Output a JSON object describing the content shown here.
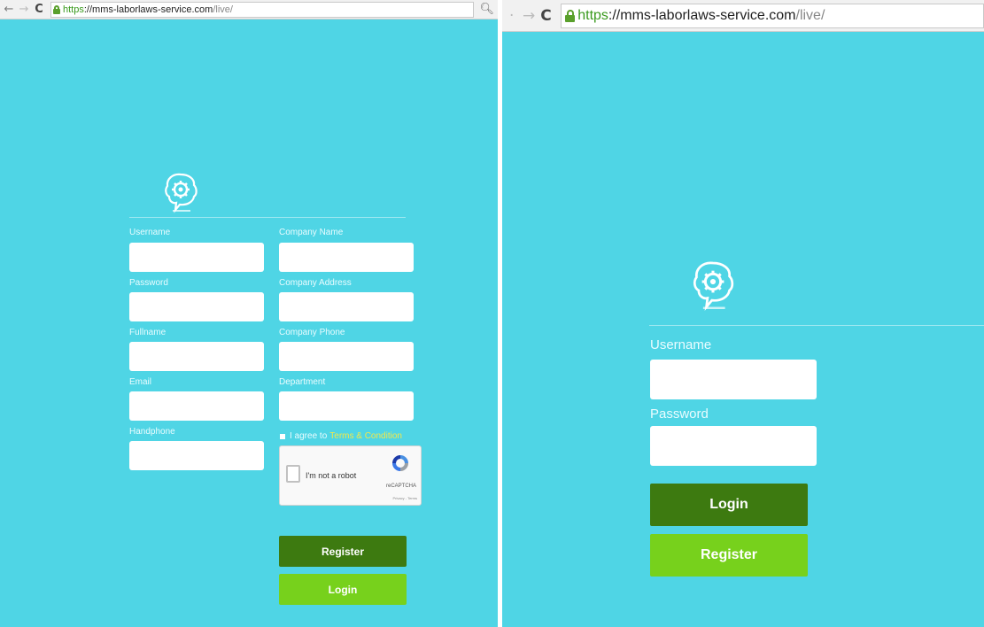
{
  "colors": {
    "page_background": "#4fd5e5",
    "dark_button": "#3d7a10",
    "light_button": "#77d11c",
    "terms_link": "#f2e84a",
    "ssl_green": "#3a9a1e"
  },
  "register_screen": {
    "browser": {
      "back_icon": "back-arrow-icon",
      "forward_icon": "forward-arrow-icon",
      "reload_icon": "reload-icon",
      "url_scheme": "https",
      "url_host": "://mms-laborlaws-service.com",
      "url_path": "/live/",
      "zoom_icon": "magnifier-icon"
    },
    "form": {
      "username_label": "Username",
      "password_label": "Password",
      "fullname_label": "Fullname",
      "email_label": "Email",
      "handphone_label": "Handphone",
      "company_name_label": "Company Name",
      "company_address_label": "Company Address",
      "company_phone_label": "Company Phone",
      "department_label": "Department",
      "agree_text": "I agree to",
      "terms_link": "Terms & Condition",
      "captcha_text": "I'm not a robot",
      "captcha_brand": "reCAPTCHA",
      "captcha_terms": "Privacy - Terms",
      "register_button": "Register",
      "login_button": "Login"
    }
  },
  "login_screen": {
    "browser": {
      "back_icon": "back-arrow-icon",
      "forward_icon": "forward-arrow-icon",
      "reload_icon": "reload-icon",
      "url_scheme": "https",
      "url_host": "://mms-laborlaws-service.com",
      "url_path": "/live/"
    },
    "form": {
      "username_label": "Username",
      "password_label": "Password",
      "login_button": "Login",
      "register_button": "Register"
    }
  }
}
